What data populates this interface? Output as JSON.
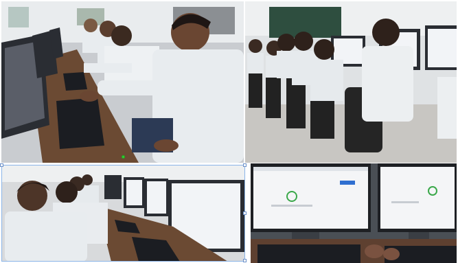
{
  "photos": [
    {
      "name": "students-row-left-view"
    },
    {
      "name": "students-back-view"
    },
    {
      "name": "students-row-close-view"
    },
    {
      "name": "monitors-closeup-view"
    }
  ],
  "colors": {
    "shirt": "#e8ecef",
    "monitor_screen": "#f2f4f7",
    "keyboard": "#1b1d22",
    "desk": "#6b4a33",
    "chalkboard": "#2e4e3f"
  }
}
